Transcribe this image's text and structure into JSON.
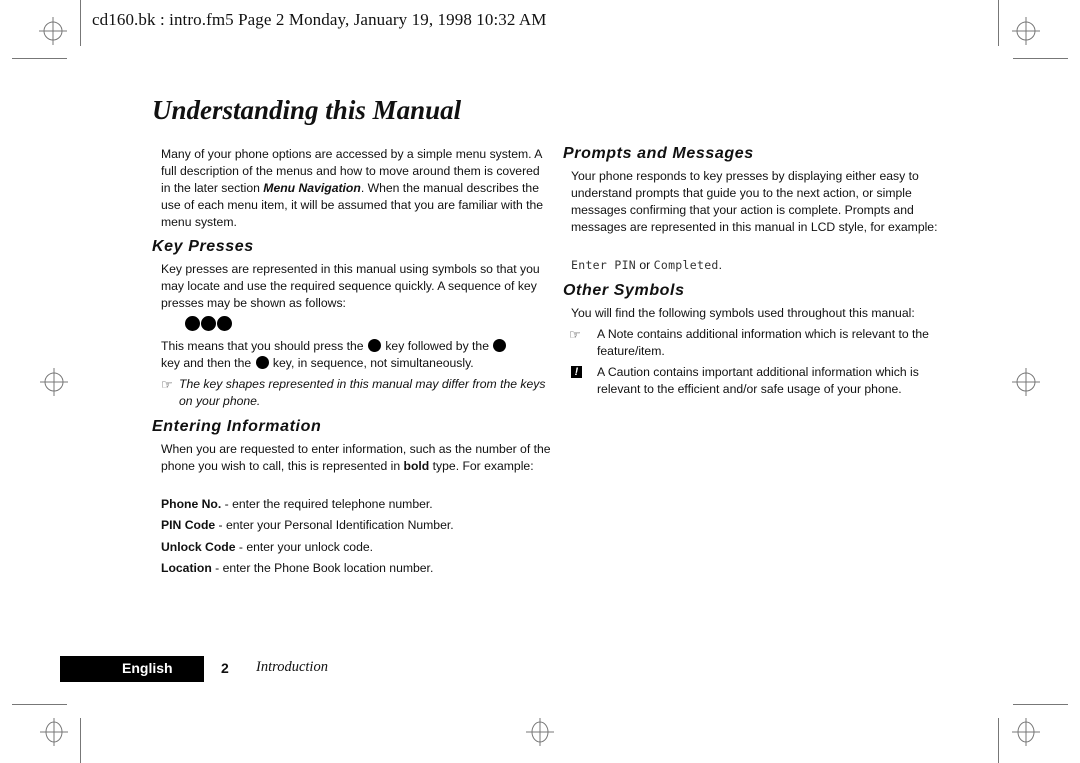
{
  "header": {
    "print_info": "cd160.bk : intro.fm5  Page 2  Monday, January 19, 1998  10:32 AM"
  },
  "page_title": "Understanding this Manual",
  "left_column": {
    "intro": {
      "text_before": "Many of your phone options are accessed by a simple menu system. A full description of the menus and how to move around them is covered in the later section ",
      "emphasis": "Menu Navigation",
      "text_after": ". When the manual describes the use of each menu item, it will be assumed that you are familiar with the menu system."
    },
    "key_presses": {
      "heading": "Key Presses",
      "paragraph": "Key presses are represented in this manual using symbols so that you may locate and use the required sequence quickly. A sequence of key presses may be shown as follows:",
      "key_sequence_icons": [
        "key-icon",
        "key-icon",
        "key-icon"
      ],
      "explanation_part1": "This means that you should press the ",
      "explanation_part2": " key followed by the ",
      "explanation_part3": "key and then the ",
      "explanation_part4": " key, in sequence, not simultaneously.",
      "note_icon": "pointing-hand-icon",
      "note": "The key shapes represented in this manual may differ from the keys on your phone."
    },
    "entering_information": {
      "heading": "Entering Information",
      "paragraph_before": "When you are requested to enter information, such as the number of the phone you wish to call, this is represented in ",
      "paragraph_bold": "bold",
      "paragraph_after": " type. For example:",
      "examples": [
        {
          "term": "Phone No.",
          "desc": " - enter the required telephone number."
        },
        {
          "term": "PIN Code",
          "desc": " - enter your Personal Identification Number."
        },
        {
          "term": "Unlock Code",
          "desc": " - enter your unlock code."
        },
        {
          "term": "Location",
          "desc": " - enter the Phone Book location number."
        }
      ]
    }
  },
  "right_column": {
    "prompts_and_messages": {
      "heading": "Prompts and Messages",
      "paragraph": "Your phone responds to key presses by displaying either easy to understand prompts that guide you to the next action, or simple messages confirming that your action is complete. Prompts and messages are represented in this manual in LCD style, for example:",
      "lcd_example_1": "Enter PIN",
      "connector": " or ",
      "lcd_example_2": "Completed",
      "end": "."
    },
    "other_symbols": {
      "heading": "Other Symbols",
      "paragraph": "You will find the following symbols used throughout this manual:",
      "items": [
        {
          "icon": "pointing-hand-icon",
          "glyph": "☞",
          "text": "A Note contains additional information which is relevant to the feature/item."
        },
        {
          "icon": "caution-icon",
          "glyph": "!",
          "text": "A Caution contains important additional information which is relevant to the efficient and/or safe usage of your phone."
        }
      ]
    }
  },
  "footer": {
    "language_tab": "English",
    "page_number": "2",
    "section_name": "Introduction"
  },
  "colors": {
    "text": "#111111",
    "crop_marks": "#777777",
    "footer_tab_bg": "#000000",
    "footer_tab_text": "#ffffff"
  }
}
